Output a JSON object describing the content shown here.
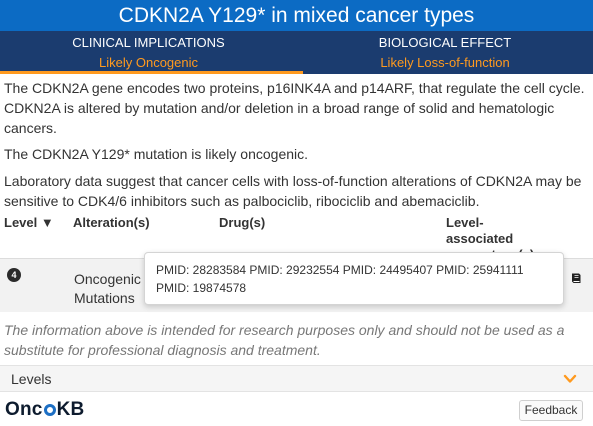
{
  "header": {
    "title": "CDKN2A Y129* in mixed cancer types"
  },
  "tabs": [
    {
      "title": "CLINICAL IMPLICATIONS",
      "value": "Likely Oncogenic",
      "active": true
    },
    {
      "title": "BIOLOGICAL EFFECT",
      "value": "Likely Loss-of-function",
      "active": false
    }
  ],
  "description": {
    "gene": "The CDKN2A gene encodes two proteins, p16INK4A and p14ARF, that regulate the cell cycle. CDKN2A is altered by mutation and/or deletion in a broad range of solid and hematologic cancers.",
    "mutation": "The CDKN2A Y129* mutation is likely oncogenic.",
    "lab": "Laboratory data suggest that cancer cells with loss-of-function alterations of CDKN2A may be sensitive to CDK4/6 inhibitors such as palbociclib, ribociclib and abemaciclib."
  },
  "table": {
    "headers": {
      "level": "Level ▼",
      "alteration": "Alteration(s)",
      "drug": "Drug(s)",
      "level_associated": "Level-associated cancer type(s)"
    },
    "rows": [
      {
        "level": "4",
        "alteration": "Oncogenic Mutations"
      }
    ]
  },
  "tooltip": {
    "text": "PMID: 28283584 PMID: 29232554 PMID: 24495407 PMID: 25941111 PMID: 19874578"
  },
  "disclaimer": "The information above is intended for research purposes only and should not be used as a substitute for professional diagnosis and treatment.",
  "levels": {
    "label": "Levels"
  },
  "footer": {
    "logo_prefix": "Onc",
    "logo_suffix": "KB",
    "feedback_label": "Feedback"
  },
  "colors": {
    "title_bg": "#0c6bc4",
    "tabs_bg": "#1b3c6f",
    "accent": "#ff9a1f"
  },
  "icons": {
    "row_action": "book-icon",
    "levels_toggle": "chevron-down-icon",
    "level_badge": "level-4-badge"
  }
}
